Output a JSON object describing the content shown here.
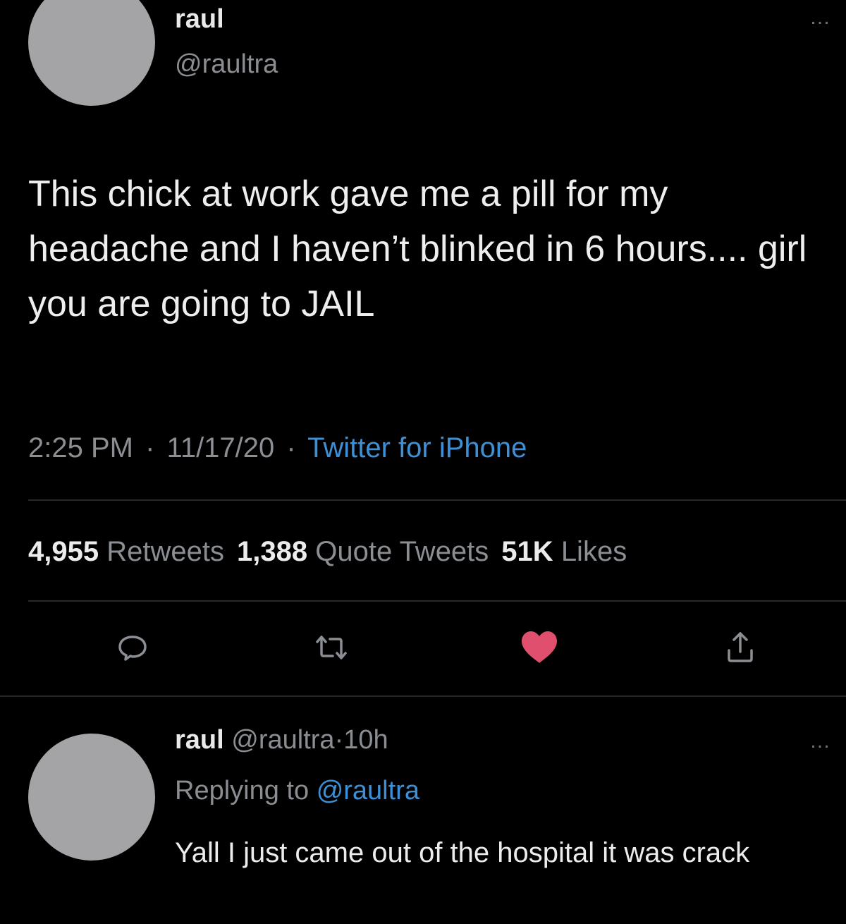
{
  "tweet": {
    "author_name": "raul",
    "author_handle": "@raultra",
    "more_glyph": "…",
    "text": "This chick at work gave me a pill for my headache and I haven’t blinked in 6 hours.... girl you are going to JAIL",
    "time": "2:25 PM",
    "date": "11/17/20",
    "separator": "·",
    "source": "Twitter for iPhone",
    "stats": {
      "retweets_count": "4,955",
      "retweets_label": "Retweets",
      "quotes_count": "1,388",
      "quotes_label": "Quote Tweets",
      "likes_count": "51K",
      "likes_label": "Likes"
    },
    "actions": {
      "reply_icon": "reply-icon",
      "retweet_icon": "retweet-icon",
      "like_icon": "heart-icon",
      "share_icon": "share-icon",
      "liked": true
    }
  },
  "reply": {
    "author_name": "raul",
    "author_handle": "@raultra",
    "separator": "·",
    "time_ago": "10h",
    "replying_prefix": "Replying to",
    "replying_to": "@raultra",
    "text": "Yall I just came out of the hospital it was crack",
    "more_glyph": "…"
  },
  "colors": {
    "background": "#000000",
    "link": "#3d8fd6",
    "like": "#e0506e",
    "secondary_text": "#8b8e92",
    "avatar": "#a4a4a6"
  }
}
